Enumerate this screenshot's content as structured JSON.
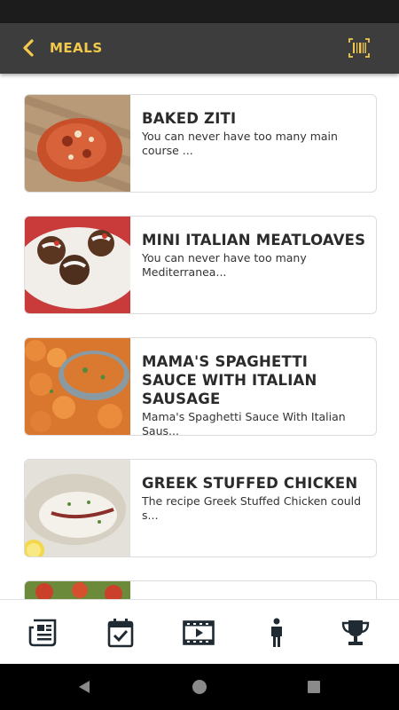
{
  "app_bar": {
    "title": "MEALS",
    "back_icon": "chevron-left-icon",
    "scan_icon": "barcode-icon",
    "accent_color": "#f2c94c",
    "background_color": "#3d3d3d"
  },
  "meals": [
    {
      "title": "BAKED ZITI",
      "description": "You can never have too many main course ...",
      "image": "baked-ziti-photo"
    },
    {
      "title": "MINI ITALIAN MEATLOAVES",
      "description": "You can never have too many Mediterranea...",
      "image": "mini-meatloaves-photo"
    },
    {
      "title": "MAMA'S SPAGHETTI SAUCE WITH ITALIAN SAUSAGE",
      "description": "Mama's Spaghetti Sauce With Italian Saus...",
      "image": "carrots-photo"
    },
    {
      "title": "GREEK STUFFED CHICKEN",
      "description": "The recipe Greek Stuffed Chicken could s...",
      "image": "stuffed-chicken-photo"
    },
    {
      "title": "",
      "description": "",
      "image": "partial-meal-photo"
    }
  ],
  "bottom_nav": {
    "items": [
      {
        "icon": "newspaper-icon"
      },
      {
        "icon": "calendar-check-icon"
      },
      {
        "icon": "video-film-icon"
      },
      {
        "icon": "person-icon"
      },
      {
        "icon": "trophy-icon"
      }
    ]
  },
  "system_nav": {
    "items": [
      {
        "icon": "back-triangle-icon"
      },
      {
        "icon": "home-circle-icon"
      },
      {
        "icon": "recents-square-icon"
      }
    ]
  }
}
